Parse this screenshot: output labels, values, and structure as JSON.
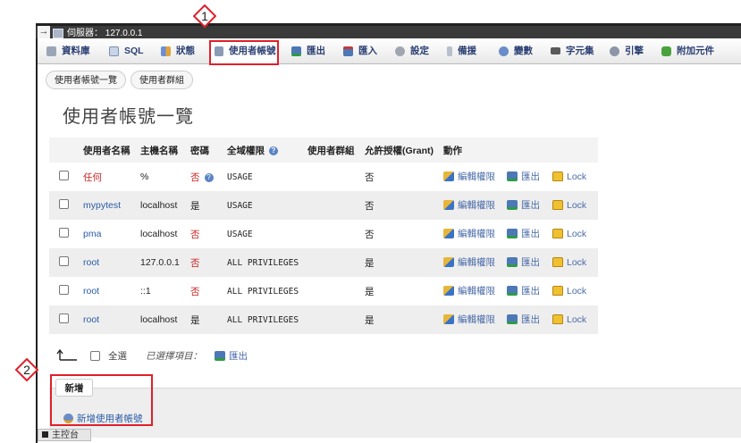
{
  "titlebar": {
    "arrow": "→",
    "server_text": "伺服器： 127.0.0.1"
  },
  "tabs": [
    {
      "label": "資料庫",
      "icon": "database-icon"
    },
    {
      "label": "SQL",
      "icon": "sql-icon"
    },
    {
      "label": "狀態",
      "icon": "status-icon"
    },
    {
      "label": "使用者帳號",
      "icon": "users-icon"
    },
    {
      "label": "匯出",
      "icon": "export-icon"
    },
    {
      "label": "匯入",
      "icon": "import-icon"
    },
    {
      "label": "設定",
      "icon": "wrench-icon"
    },
    {
      "label": "備援",
      "icon": "replication-icon"
    },
    {
      "label": "變數",
      "icon": "variables-icon"
    },
    {
      "label": "字元集",
      "icon": "charset-icon"
    },
    {
      "label": "引擎",
      "icon": "engine-icon"
    },
    {
      "label": "附加元件",
      "icon": "plugin-icon"
    }
  ],
  "subtabs": [
    "使用者帳號一覽",
    "使用者群組"
  ],
  "heading": "使用者帳號一覽",
  "table": {
    "headers": [
      "使用者名稱",
      "主機名稱",
      "密碼",
      "全域權限",
      "使用者群組",
      "允許授權(Grant)",
      "動作"
    ],
    "rows": [
      {
        "user": "任何",
        "host": "%",
        "password": "否",
        "privileges": "USAGE",
        "group": "",
        "grant": "否"
      },
      {
        "user": "mypytest",
        "host": "localhost",
        "password": "是",
        "privileges": "USAGE",
        "group": "",
        "grant": "否"
      },
      {
        "user": "pma",
        "host": "localhost",
        "password": "否",
        "privileges": "USAGE",
        "group": "",
        "grant": "否"
      },
      {
        "user": "root",
        "host": "127.0.0.1",
        "password": "否",
        "privileges": "ALL PRIVILEGES",
        "group": "",
        "grant": "是"
      },
      {
        "user": "root",
        "host": "::1",
        "password": "否",
        "privileges": "ALL PRIVILEGES",
        "group": "",
        "grant": "是"
      },
      {
        "user": "root",
        "host": "localhost",
        "password": "是",
        "privileges": "ALL PRIVILEGES",
        "group": "",
        "grant": "是"
      }
    ],
    "actions": {
      "edit": "編輯權限",
      "export": "匯出",
      "lock": "Lock"
    }
  },
  "bulk": {
    "select_all": "全選",
    "with_selected": "已選擇項目：",
    "export": "匯出"
  },
  "new_section": {
    "title": "新增",
    "add_user": "新增使用者帳號"
  },
  "console": "主控台",
  "badges": [
    "1",
    "2"
  ],
  "colors": {
    "highlight": "#e0202a",
    "link": "#2a5ca8",
    "no_red": "#cc1f1f"
  }
}
